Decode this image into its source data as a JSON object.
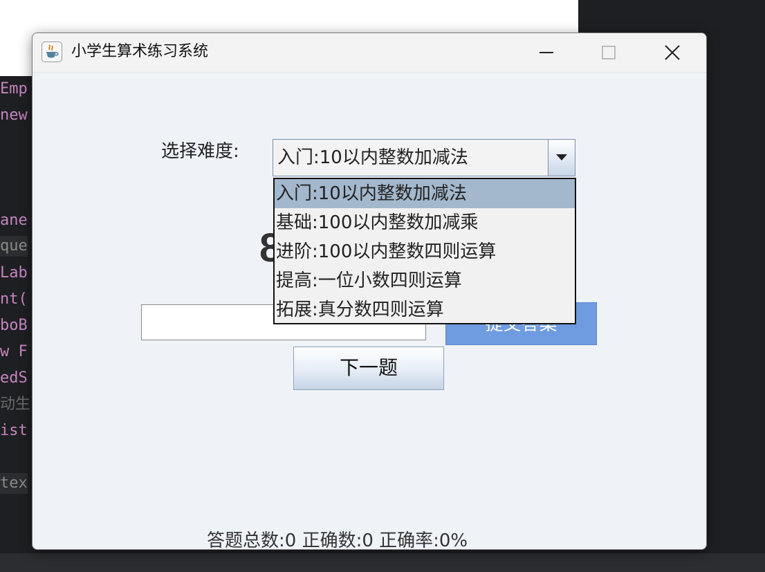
{
  "window": {
    "title": "小学生算术练习系统"
  },
  "background_code": [
    {
      "text": "Emp",
      "color": "#c586c0"
    },
    {
      "text": "new",
      "color": "#c586c0"
    },
    {
      "text": "ane",
      "color": "#c586c0"
    },
    {
      "text": "que",
      "color": "#8a8a8a"
    },
    {
      "text": "Lab",
      "color": "#c586c0"
    },
    {
      "text": "nt(",
      "color": "#c586c0"
    },
    {
      "text": "boB",
      "color": "#c586c0"
    },
    {
      "text": "w F",
      "color": "#c586c0"
    },
    {
      "text": "edS",
      "color": "#c586c0"
    },
    {
      "text": "动生瓦",
      "color": "#6a6a6a"
    },
    {
      "text": "ist",
      "color": "#c586c0"
    },
    {
      "text": "tex",
      "color": "#8a8a8a"
    }
  ],
  "difficulty": {
    "label": "选择难度:",
    "selected": "入门:10以内整数加减法",
    "options": [
      "入门:10以内整数加减法",
      "基础:100以内整数加减乘",
      "进阶:100以内整数四则运算",
      "提高:一位小数四则运算",
      "拓展:真分数四则运算"
    ],
    "selected_index": 0
  },
  "question": {
    "visible_fragment": "8"
  },
  "answer": {
    "value": "",
    "placeholder": ""
  },
  "buttons": {
    "submit": "提交答案",
    "next": "下一题"
  },
  "stats": {
    "text": "答题总数:0  正确数:0  正确率:0%"
  },
  "colors": {
    "window_bg": "#eff3f8",
    "submit_bg": "#6f9be0",
    "dropdown_selected": "#a3b8cc"
  }
}
